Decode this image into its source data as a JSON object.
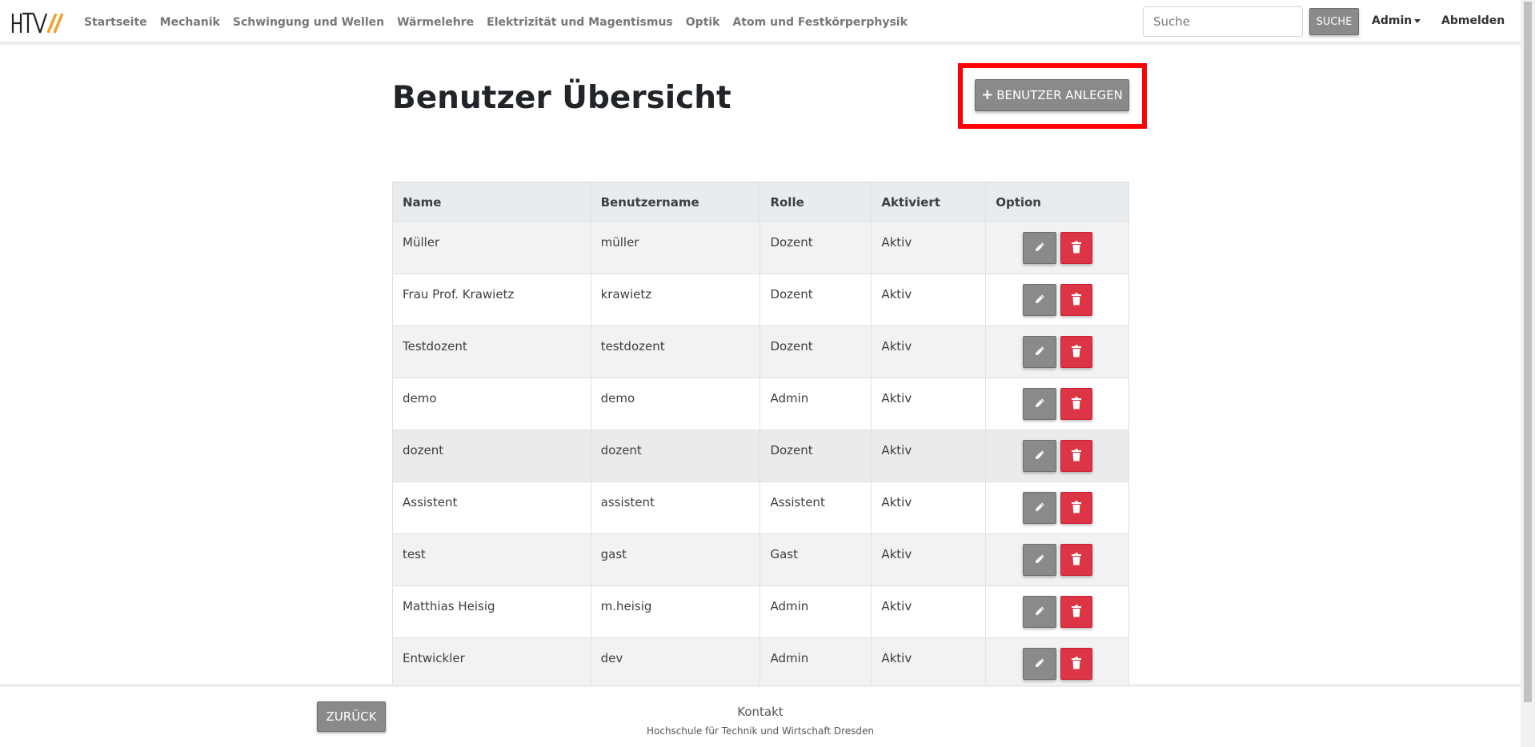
{
  "navbar": {
    "links": [
      "Startseite",
      "Mechanik",
      "Schwingung und Wellen",
      "Wärmelehre",
      "Elektrizität und Magentismus",
      "Optik",
      "Atom und Festkörperphysik"
    ],
    "search": {
      "placeholder": "Suche",
      "value": ""
    },
    "search_button": "SUCHE",
    "admin_menu": "Admin",
    "logout": "Abmelden"
  },
  "main": {
    "title": "Benutzer Übersicht",
    "add_user_button": "BENUTZER ANLEGEN"
  },
  "table": {
    "headers": [
      "Name",
      "Benutzername",
      "Rolle",
      "Aktiviert",
      "Option"
    ],
    "rows": [
      {
        "name": "Müller",
        "username": "müller",
        "role": "Dozent",
        "active": "Aktiv"
      },
      {
        "name": "Frau Prof. Krawietz",
        "username": "krawietz",
        "role": "Dozent",
        "active": "Aktiv"
      },
      {
        "name": "Testdozent",
        "username": "testdozent",
        "role": "Dozent",
        "active": "Aktiv"
      },
      {
        "name": "demo",
        "username": "demo",
        "role": "Admin",
        "active": "Aktiv"
      },
      {
        "name": "dozent",
        "username": "dozent",
        "role": "Dozent",
        "active": "Aktiv"
      },
      {
        "name": "Assistent",
        "username": "assistent",
        "role": "Assistent",
        "active": "Aktiv"
      },
      {
        "name": "test",
        "username": "gast",
        "role": "Gast",
        "active": "Aktiv"
      },
      {
        "name": "Matthias Heisig",
        "username": "m.heisig",
        "role": "Admin",
        "active": "Aktiv"
      },
      {
        "name": "Entwickler",
        "username": "dev",
        "role": "Admin",
        "active": "Aktiv"
      }
    ]
  },
  "footer": {
    "back_button": "ZURÜCK",
    "contact": "Kontakt",
    "organization": "Hochschule für Technik und Wirtschaft Dresden"
  },
  "colors": {
    "primary_button": "#8a8a8a",
    "danger_button": "#dc3545",
    "highlight": "#ff0000",
    "logo_accent": "#f0a030"
  },
  "icons": {
    "edit": "pencil-icon",
    "delete": "trash-icon",
    "add": "plus-icon"
  }
}
